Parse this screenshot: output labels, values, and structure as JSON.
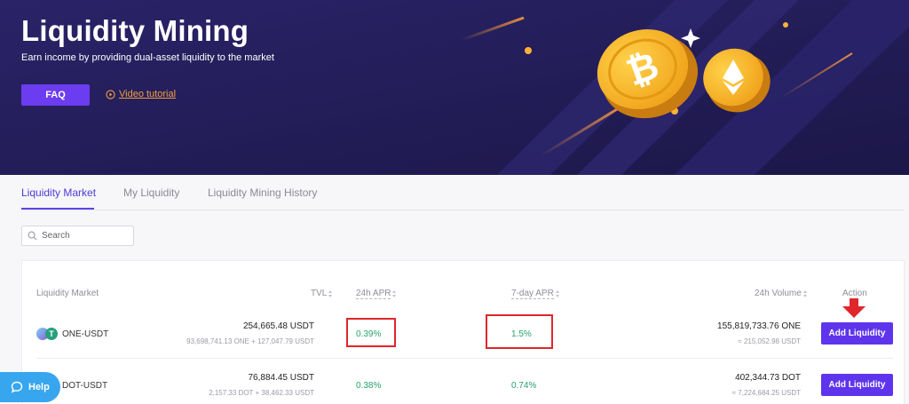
{
  "banner": {
    "title": "Liquidity Mining",
    "subtitle": "Earn income by providing dual-asset liquidity to the market",
    "faq_label": "FAQ",
    "video_label": "Video tutorial",
    "icons": [
      "play-icon",
      "bitcoin-coin",
      "ethereum-coin",
      "sparkle"
    ]
  },
  "tabs": [
    {
      "label": "Liquidity Market",
      "active": true
    },
    {
      "label": "My Liquidity",
      "active": false
    },
    {
      "label": "Liquidity Mining History",
      "active": false
    }
  ],
  "search": {
    "placeholder": "Search"
  },
  "table": {
    "headers": {
      "market": "Liquidity Market",
      "tvl": "TVL",
      "apr24": "24h APR",
      "apr7": "7-day APR",
      "volume": "24h Volume",
      "action": "Action"
    },
    "rows": [
      {
        "pair": "ONE-USDT",
        "tvl": "254,665.48 USDT",
        "tvl_detail": "93,698,741.13 ONE + 127,047.79 USDT",
        "apr24": "0.39%",
        "apr7": "1.5%",
        "volume": "155,819,733.76 ONE",
        "volume_detail": "≈ 215,052.98 USDT",
        "action": "Add Liquidity"
      },
      {
        "pair": "DOT-USDT",
        "tvl": "76,884.45 USDT",
        "tvl_detail": "2,157.33 DOT + 38,462.33 USDT",
        "apr24": "0.38%",
        "apr7": "0.74%",
        "volume": "402,344.73 DOT",
        "volume_detail": "≈ 7,224,684.25 USDT",
        "action": "Add Liquidity"
      }
    ]
  },
  "help": {
    "label": "Help"
  },
  "colors": {
    "banner_bg": "#221d55",
    "accent": "#5e35ec",
    "positive": "#27a36a",
    "link_orange": "#f0a03c",
    "highlight_red": "#e0262b",
    "help_blue": "#38a6ef"
  }
}
